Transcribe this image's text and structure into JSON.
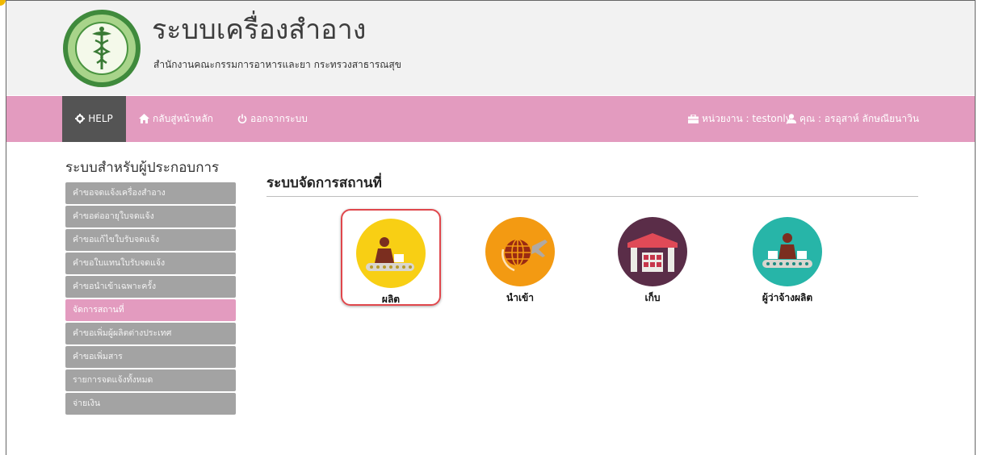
{
  "header": {
    "title": "ระบบเครื่องสำอาง",
    "subtitle": "สำนักงานคณะกรรมการอาหารและยา กระทรวงสาธารณสุข"
  },
  "nav": {
    "help": "HELP",
    "home": "กลับสู่หน้าหลัก",
    "logout": "ออกจากระบบ",
    "unit": "หน่วยงาน : testonly",
    "user": "คุณ : อรอุสาห์ ลักษณียนาวิน"
  },
  "sidebar": {
    "title": "ระบบสำหรับผู้ประกอบการ",
    "items": [
      {
        "label": "คำขอจดแจ้งเครื่องสำอาง"
      },
      {
        "label": "คำขอต่ออายุใบจดแจ้ง"
      },
      {
        "label": "คำขอแก้ไขใบรับจดแจ้ง"
      },
      {
        "label": "คำขอใบแทนใบรับจดแจ้ง"
      },
      {
        "label": "คำขอนำเข้าเฉพาะครั้ง"
      },
      {
        "label": "จัดการสถานที่",
        "active": true
      },
      {
        "label": "คำขอเพิ่มผู้ผลิตต่างประเทศ"
      },
      {
        "label": "คำขอเพิ่มสาร"
      },
      {
        "label": "รายการจดแจ้งทั้งหมด"
      },
      {
        "label": "จ่ายเงิน"
      }
    ]
  },
  "main": {
    "title": "ระบบจัดการสถานที่",
    "tiles": [
      {
        "label": "ผลิต",
        "icon": "worker-conveyor-icon",
        "color": "#f8cf14",
        "selected": true
      },
      {
        "label": "นำเข้า",
        "icon": "globe-plane-icon",
        "color": "#f39a12"
      },
      {
        "label": "เก็บ",
        "icon": "warehouse-icon",
        "color": "#5a2d48"
      },
      {
        "label": "ผู้ว่าจ้างผลิต",
        "icon": "worker-conveyor-icon",
        "color": "#27b5a8"
      }
    ]
  },
  "colors": {
    "navbar": "#e39bbf",
    "help_bg": "#545454",
    "menu_bg": "#a3a3a3",
    "menu_active": "#e39bbf",
    "selected_border": "#e0474c"
  }
}
